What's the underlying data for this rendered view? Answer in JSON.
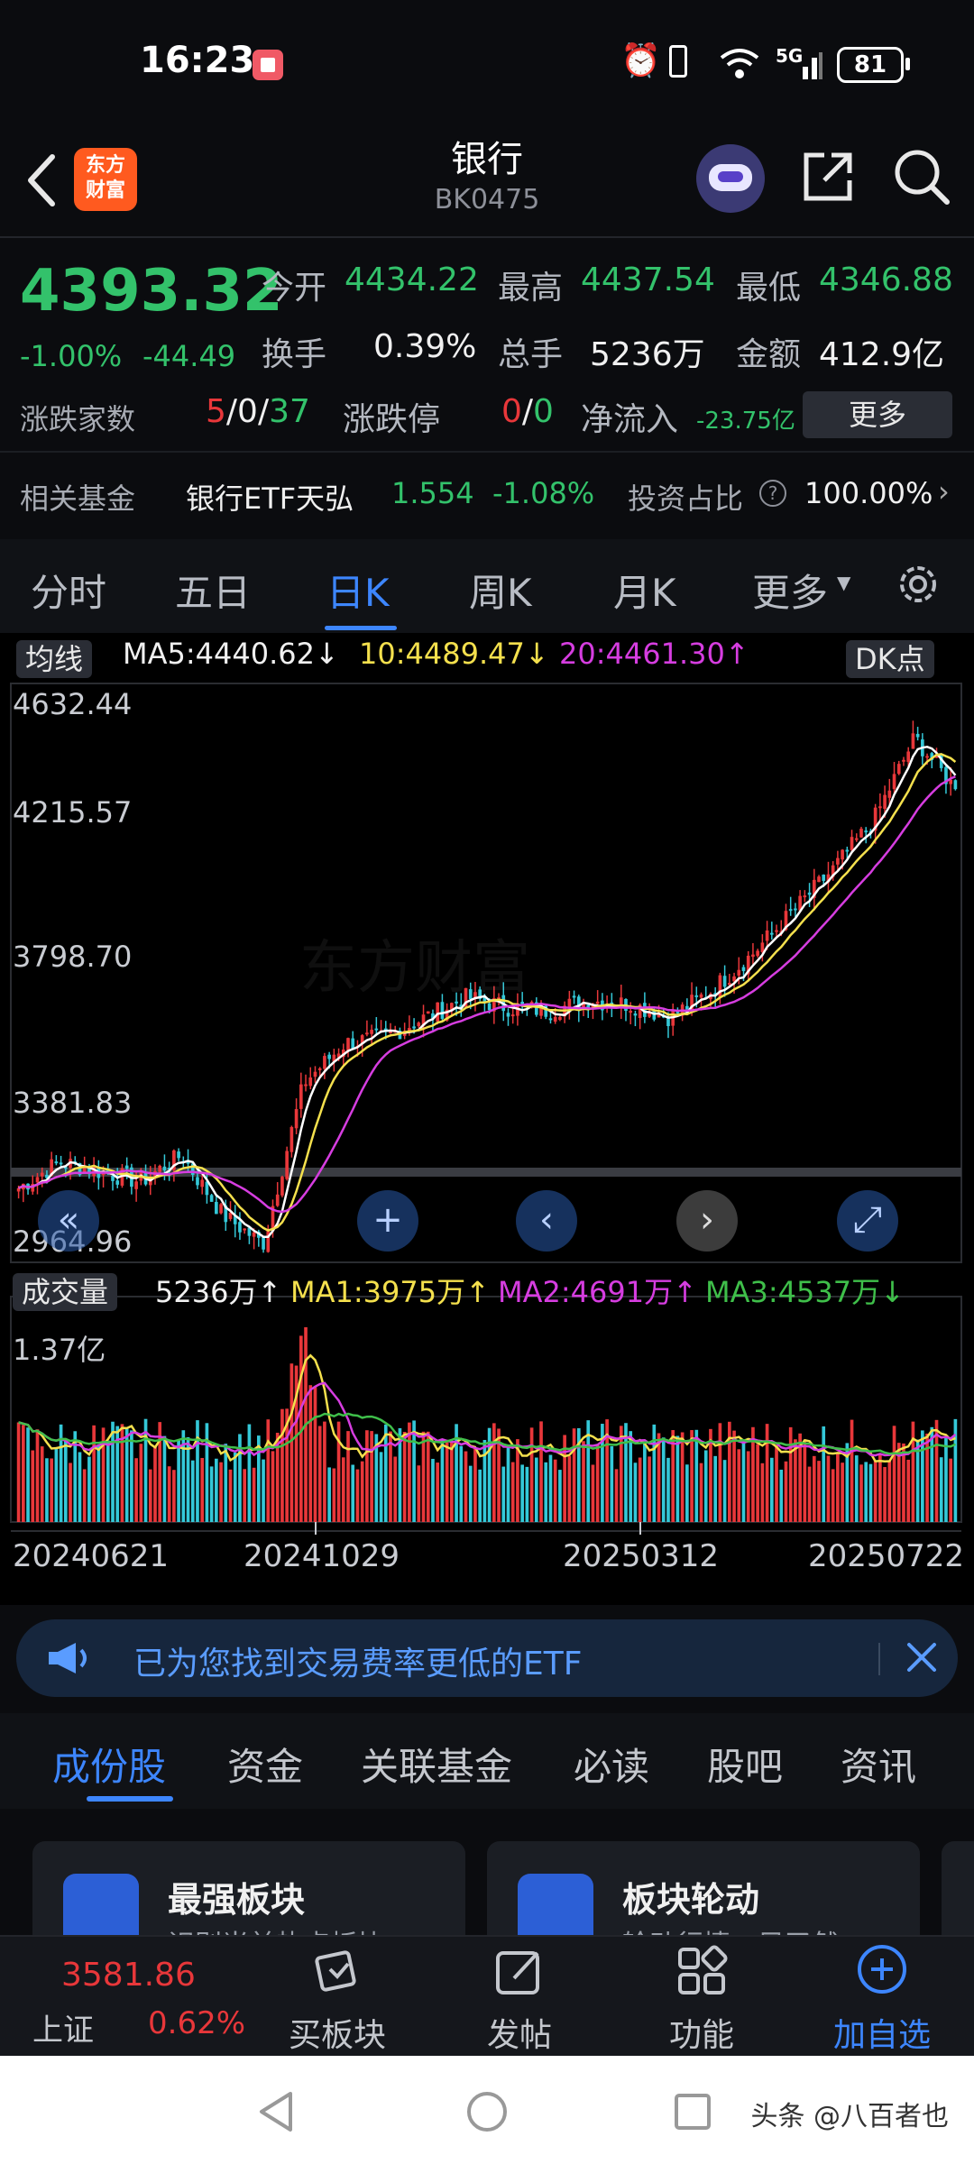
{
  "status": {
    "time": "16:23",
    "battery": "81",
    "icons": "⏰ ▯ 📶 5G"
  },
  "header": {
    "logo_text": "东方\n财富",
    "title": "银行",
    "code": "BK0475"
  },
  "quote": {
    "price": "4393.32",
    "change_pct": "-1.00%",
    "change": "-44.49",
    "open_label": "今开",
    "open": "4434.22",
    "high_label": "最高",
    "high": "4437.54",
    "low_label": "最低",
    "low": "4346.88",
    "turnover_label": "换手",
    "turnover": "0.39%",
    "volume_label": "总手",
    "volume": "5236万",
    "amount_label": "金额",
    "amount": "412.9亿",
    "updown_label": "涨跌家数",
    "up": "5",
    "flat": "0",
    "down": "37",
    "sep": "/",
    "limit_label": "涨跌停",
    "limit_up": "0",
    "limit_down": "0",
    "netflow_label": "净流入",
    "netflow": "-23.75亿",
    "more": "更多",
    "fund_label": "相关基金",
    "fund_name": "银行ETF天弘",
    "fund_price": "1.554",
    "fund_pct": "-1.08%",
    "ratio_label": "投资占比",
    "ratio": "100.00%"
  },
  "ktabs": [
    "分时",
    "五日",
    "日K",
    "周K",
    "月K",
    "更多"
  ],
  "chart": {
    "ma_chip": "均线",
    "ma5": "MA5:4440.62↓",
    "ma10": "10:4489.47↓",
    "ma20": "20:4461.30↑",
    "dk_chip": "DK点",
    "y_labels": [
      "4632.44",
      "4215.57",
      "3798.70",
      "3381.83",
      "2964.96"
    ],
    "vol_chip": "成交量",
    "vol_now": "5236万↑",
    "vol_ma1": "MA1:3975万↑",
    "vol_ma2": "MA2:4691万↑",
    "vol_ma3": "MA3:4537万↓",
    "vol_max": "1.37亿",
    "dates": [
      "20240621",
      "20241029",
      "20250312",
      "20250722"
    ],
    "watermark": "东方财富"
  },
  "chart_data": {
    "type": "candlestick",
    "ylim": [
      2964.96,
      4632.44
    ],
    "y_ticks": [
      4632.44,
      4215.57,
      3798.7,
      3381.83,
      2964.96
    ],
    "x_ticks": [
      "20240621",
      "20241029",
      "20250312",
      "20250722"
    ],
    "close_path": [
      [
        "20240621",
        3180
      ],
      [
        "20240701",
        3260
      ],
      [
        "20240715",
        3230
      ],
      [
        "20240801",
        3200
      ],
      [
        "20240815",
        3280
      ],
      [
        "20240901",
        3100
      ],
      [
        "20240920",
        3010
      ],
      [
        "20241008",
        3500
      ],
      [
        "20241029",
        3620
      ],
      [
        "20241115",
        3640
      ],
      [
        "20241201",
        3700
      ],
      [
        "20241220",
        3760
      ],
      [
        "20250110",
        3730
      ],
      [
        "20250201",
        3720
      ],
      [
        "20250220",
        3750
      ],
      [
        "20250312",
        3740
      ],
      [
        "20250401",
        3700
      ],
      [
        "20250420",
        3780
      ],
      [
        "20250510",
        3890
      ],
      [
        "20250601",
        4020
      ],
      [
        "20250620",
        4150
      ],
      [
        "20250701",
        4300
      ],
      [
        "20250715",
        4550
      ],
      [
        "20250722",
        4393.32
      ]
    ],
    "latest_close": 4393.32,
    "ma5": 4440.62,
    "ma10": 4489.47,
    "ma20": 4461.3,
    "volume_max": "1.37亿",
    "latest_volume": "5236万"
  },
  "promo": {
    "text": "已为您找到交易费率更低的ETF"
  },
  "sectabs": [
    "成份股",
    "资金",
    "关联基金",
    "必读",
    "股吧",
    "资讯"
  ],
  "cards": [
    {
      "title": "最强板块",
      "sub": "识别当前热点板块"
    },
    {
      "title": "板块轮动",
      "sub": "轮动行情一目了然"
    }
  ],
  "bnav": {
    "index_value": "3581.86",
    "index_name": "上证",
    "index_pct": "0.62%",
    "items": [
      "买板块",
      "发帖",
      "功能",
      "加自选"
    ]
  },
  "watermark": "头条 @八百者也"
}
